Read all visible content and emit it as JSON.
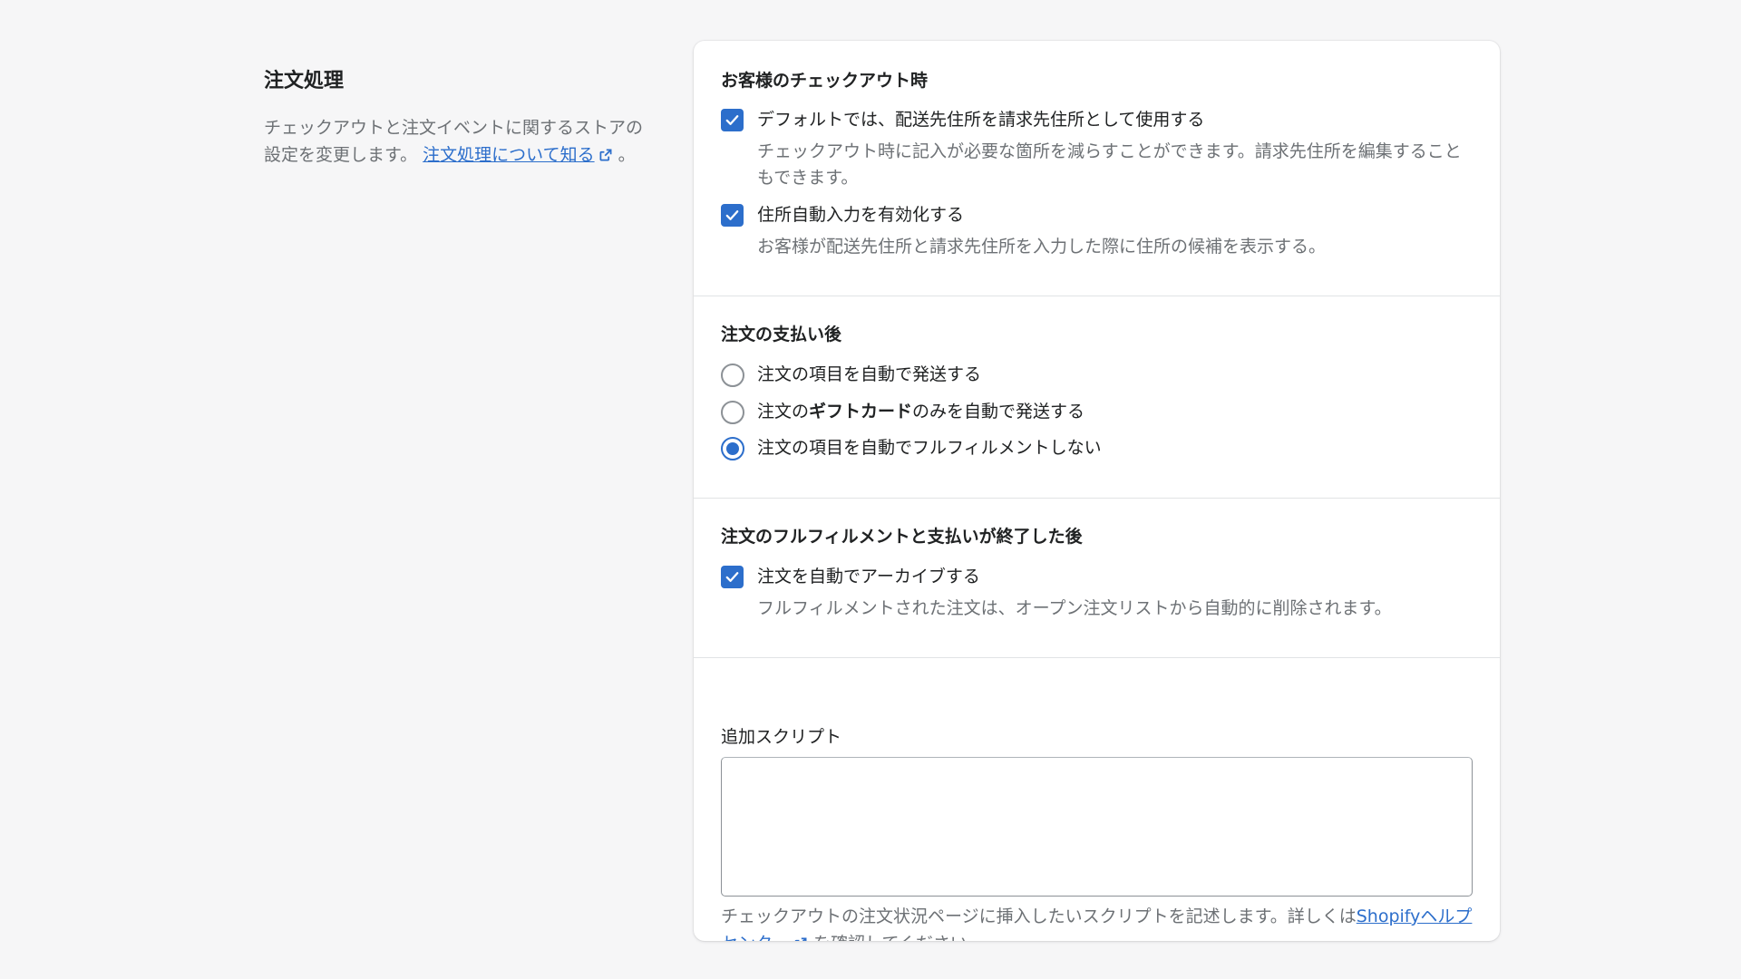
{
  "annotation": {
    "title": "注文処理",
    "description": "チェックアウトと注文イベントに関するストアの設定を変更します。",
    "link_label": "注文処理について知る",
    "suffix": "。"
  },
  "checkout": {
    "title": "お客様のチェックアウト時",
    "options": [
      {
        "label": "デフォルトでは、配送先住所を請求先住所として使用する",
        "help": "チェックアウト時に記入が必要な箇所を減らすことができます。請求先住所を編集することもできます。",
        "checked": true
      },
      {
        "label": "住所自動入力を有効化する",
        "help": "お客様が配送先住所と請求先住所を入力した際に住所の候補を表示する。",
        "checked": true
      }
    ]
  },
  "after_payment": {
    "title": "注文の支払い後",
    "options": [
      {
        "label_pre": "注文の項目を自動で発送する",
        "label_bold": "",
        "label_post": "",
        "selected": false
      },
      {
        "label_pre": "注文の",
        "label_bold": "ギフトカード",
        "label_post": "のみを自動で発送する",
        "selected": false
      },
      {
        "label_pre": "注文の項目を自動でフルフィルメントしない",
        "label_bold": "",
        "label_post": "",
        "selected": true
      }
    ]
  },
  "after_fulfillment": {
    "title": "注文のフルフィルメントと支払いが終了した後",
    "option": {
      "label": "注文を自動でアーカイブする",
      "help": "フルフィルメントされた注文は、オープン注文リストから自動的に削除されます。",
      "checked": true
    }
  },
  "scripts": {
    "label": "追加スクリプト",
    "value": "",
    "help_pre": "チェックアウトの注文状況ページに挿入したいスクリプトを記述します。詳しくは",
    "help_link": "Shopifyヘルプセンター",
    "help_post": " を確認してください。"
  },
  "colors": {
    "accent": "#2c6ecb",
    "background": "#f6f6f7",
    "card": "#ffffff",
    "subdued_text": "#6d7175"
  }
}
